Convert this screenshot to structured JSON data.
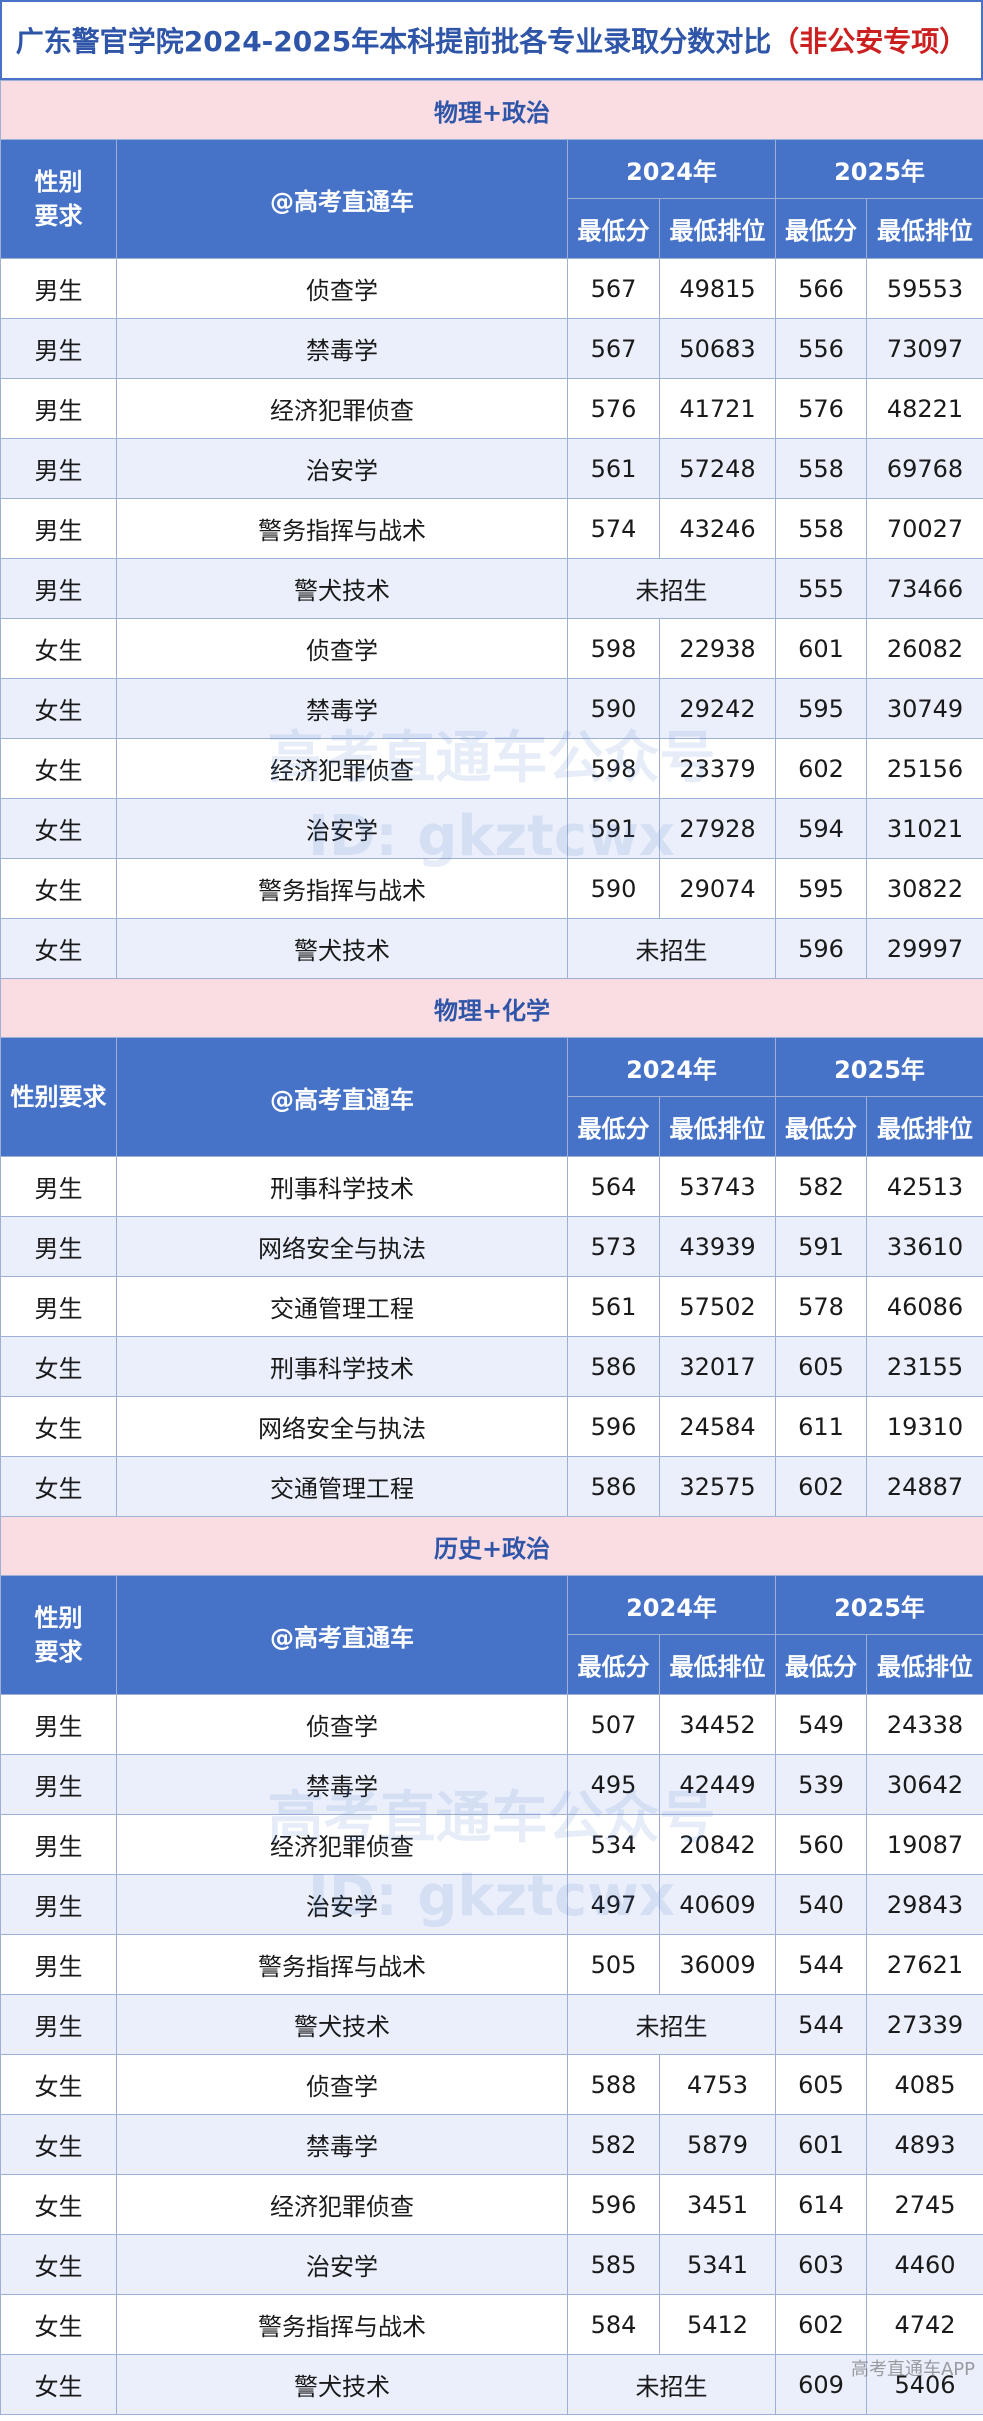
{
  "title": {
    "main": "广东警官学院2024-2025年本科提前批各专业录取分数对比",
    "highlight": "（非公安专项）"
  },
  "columns": {
    "gender": "性别要求",
    "major": "@高考直通车",
    "year1": "2024年",
    "year2": "2025年",
    "min_score": "最低分",
    "min_rank": "最低排位"
  },
  "not_enrolled": "未招生",
  "sections": [
    {
      "name": "物理+政治",
      "rows": [
        [
          "男生",
          "侦查学",
          "567",
          "49815",
          "566",
          "59553"
        ],
        [
          "男生",
          "禁毒学",
          "567",
          "50683",
          "556",
          "73097"
        ],
        [
          "男生",
          "经济犯罪侦查",
          "576",
          "41721",
          "576",
          "48221"
        ],
        [
          "男生",
          "治安学",
          "561",
          "57248",
          "558",
          "69768"
        ],
        [
          "男生",
          "警务指挥与战术",
          "574",
          "43246",
          "558",
          "70027"
        ],
        [
          "男生",
          "警犬技术",
          "",
          "",
          "555",
          "73466"
        ],
        [
          "女生",
          "侦查学",
          "598",
          "22938",
          "601",
          "26082"
        ],
        [
          "女生",
          "禁毒学",
          "590",
          "29242",
          "595",
          "30749"
        ],
        [
          "女生",
          "经济犯罪侦查",
          "598",
          "23379",
          "602",
          "25156"
        ],
        [
          "女生",
          "治安学",
          "591",
          "27928",
          "594",
          "31021"
        ],
        [
          "女生",
          "警务指挥与战术",
          "590",
          "29074",
          "595",
          "30822"
        ],
        [
          "女生",
          "警犬技术",
          "",
          "",
          "596",
          "29997"
        ]
      ]
    },
    {
      "name": "物理+化学",
      "rows": [
        [
          "男生",
          "刑事科学技术",
          "564",
          "53743",
          "582",
          "42513"
        ],
        [
          "男生",
          "网络安全与执法",
          "573",
          "43939",
          "591",
          "33610"
        ],
        [
          "男生",
          "交通管理工程",
          "561",
          "57502",
          "578",
          "46086"
        ],
        [
          "女生",
          "刑事科学技术",
          "586",
          "32017",
          "605",
          "23155"
        ],
        [
          "女生",
          "网络安全与执法",
          "596",
          "24584",
          "611",
          "19310"
        ],
        [
          "女生",
          "交通管理工程",
          "586",
          "32575",
          "602",
          "24887"
        ]
      ]
    },
    {
      "name": "历史+政治",
      "rows": [
        [
          "男生",
          "侦查学",
          "507",
          "34452",
          "549",
          "24338"
        ],
        [
          "男生",
          "禁毒学",
          "495",
          "42449",
          "539",
          "30642"
        ],
        [
          "男生",
          "经济犯罪侦查",
          "534",
          "20842",
          "560",
          "19087"
        ],
        [
          "男生",
          "治安学",
          "497",
          "40609",
          "540",
          "29843"
        ],
        [
          "男生",
          "警务指挥与战术",
          "505",
          "36009",
          "544",
          "27621"
        ],
        [
          "男生",
          "警犬技术",
          "",
          "",
          "544",
          "27339"
        ],
        [
          "女生",
          "侦查学",
          "588",
          "4753",
          "605",
          "4085"
        ],
        [
          "女生",
          "禁毒学",
          "582",
          "5879",
          "601",
          "4893"
        ],
        [
          "女生",
          "经济犯罪侦查",
          "596",
          "3451",
          "614",
          "2745"
        ],
        [
          "女生",
          "治安学",
          "585",
          "5341",
          "603",
          "4460"
        ],
        [
          "女生",
          "警务指挥与战术",
          "584",
          "5412",
          "602",
          "4742"
        ],
        [
          "女生",
          "警犬技术",
          "",
          "",
          "609",
          "5406"
        ]
      ]
    }
  ],
  "watermarks": [
    "高考直通车公众号",
    "ID: gkztcwx"
  ],
  "footer_mark": "高考直通车APP"
}
